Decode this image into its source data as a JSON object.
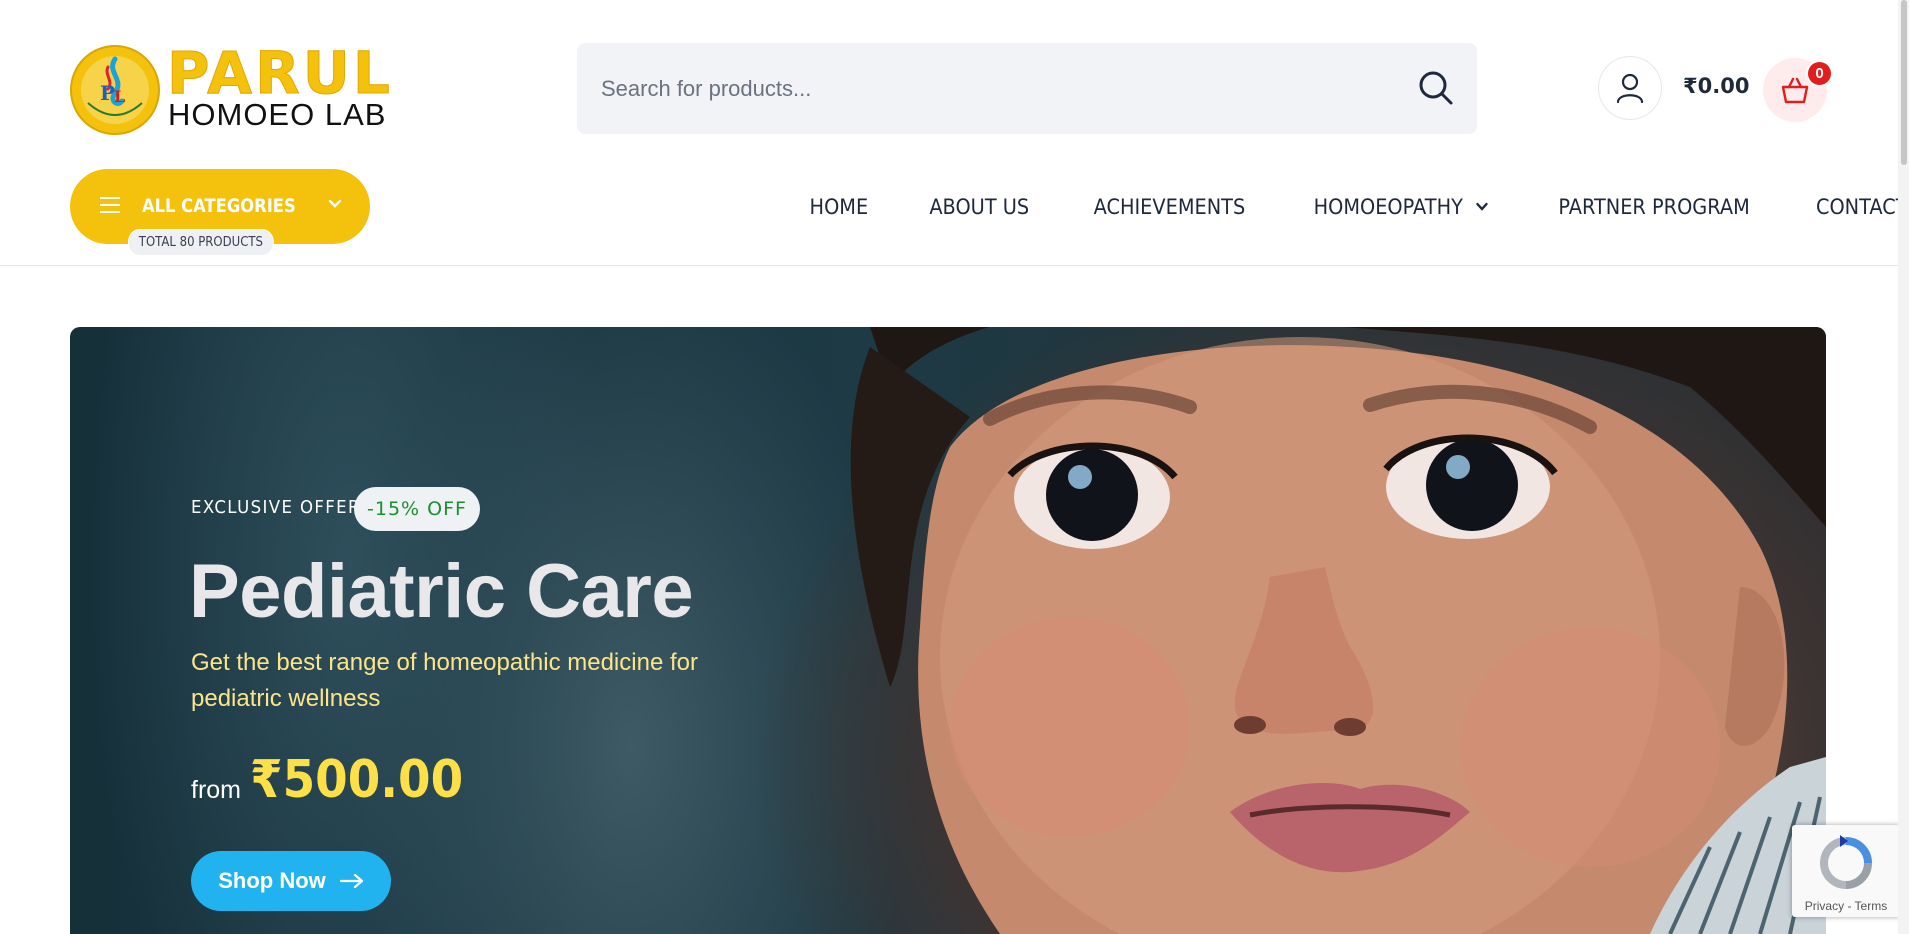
{
  "brand": {
    "name": "PARUL",
    "subtitle": "HOMOEO LAB",
    "emblem_initials": "PHL",
    "colors": {
      "primary_yellow": "#f4c20d",
      "accent_blue": "#21b3f0",
      "badge_red": "#e11d1d"
    }
  },
  "search": {
    "placeholder": "Search for products...",
    "value": ""
  },
  "header": {
    "cart_total": "₹0.00",
    "cart_count": "0"
  },
  "categories": {
    "label": "ALL CATEGORIES",
    "count_label": "TOTAL 80 PRODUCTS"
  },
  "nav": {
    "items": [
      {
        "label": "HOME"
      },
      {
        "label": "ABOUT US"
      },
      {
        "label": "ACHIEVEMENTS"
      },
      {
        "label": "HOMOEOPATHY",
        "has_dropdown": true
      },
      {
        "label": "PARTNER PROGRAM"
      },
      {
        "label": "CONTACT"
      }
    ]
  },
  "hero": {
    "offer_label": "EXCLUSIVE OFFER",
    "discount_badge": "-15% OFF",
    "title": "Pediatric Care",
    "description": "Get the best range of homeopathic medicine for pediatric wellness",
    "from_label": "from",
    "price": "₹500.00",
    "cta_label": "Shop Now"
  },
  "recaptcha": {
    "links": "Privacy - Terms"
  }
}
